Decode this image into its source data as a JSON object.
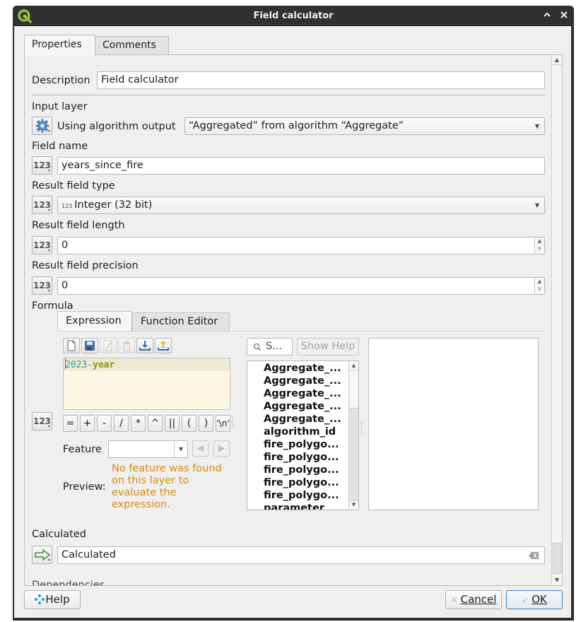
{
  "window": {
    "title": "Field calculator",
    "controls": {
      "shade": "^",
      "close": "✕"
    }
  },
  "tabs": [
    {
      "label": "Properties",
      "active": true
    },
    {
      "label": "Comments",
      "active": false
    }
  ],
  "form": {
    "description": {
      "label": "Description",
      "value": "Field calculator"
    },
    "input_layer": {
      "label": "Input layer",
      "source_label": "Using algorithm output",
      "value": "“Aggregated” from algorithm “Aggregate”"
    },
    "field_name": {
      "label": "Field name",
      "value": "years_since_fire"
    },
    "result_field_type": {
      "label": "Result field type",
      "type_badge": "123",
      "value": "Integer (32 bit)"
    },
    "result_field_length": {
      "label": "Result field length",
      "value": "0"
    },
    "result_field_precision": {
      "label": "Result field precision",
      "value": "0"
    },
    "formula": {
      "label": "Formula"
    },
    "calculated": {
      "label": "Calculated",
      "value": "Calculated"
    },
    "dependencies": {
      "label": "Dependencies"
    },
    "source_button_label": "123"
  },
  "expression_builder": {
    "tabs": [
      {
        "label": "Expression",
        "active": true
      },
      {
        "label": "Function Editor",
        "active": false
      }
    ],
    "toolbar": [
      "new-expression",
      "save-expression",
      "edit-expression",
      "delete-expression",
      "import-expressions",
      "export-expressions"
    ],
    "expression": {
      "number": "2023",
      "operator": "-",
      "field": "year"
    },
    "operators": [
      "=",
      "+",
      "-",
      "/",
      "*",
      "^",
      "||",
      "(",
      ")",
      "'\\n'"
    ],
    "feature": {
      "label": "Feature",
      "value": ""
    },
    "preview": {
      "label": "Preview:",
      "message": "No feature was found on this layer to evaluate the expression."
    },
    "search": {
      "placeholder": "S..."
    },
    "show_help_label": "Show Help",
    "function_list": [
      "Aggregate_...",
      "Aggregate_...",
      "Aggregate_...",
      "Aggregate_...",
      "Aggregate_...",
      "algorithm_id",
      "fire_polygo...",
      "fire_polygo...",
      "fire_polygo...",
      "fire_polygo...",
      "fire_polygo...",
      "parameter"
    ]
  },
  "buttons": {
    "help": "Help",
    "cancel": "Cancel",
    "ok": "OK"
  },
  "colors": {
    "preview_warning": "#d98a12",
    "editor_background": "#fdf6e3",
    "default_button_border": "#3d7eb8"
  }
}
